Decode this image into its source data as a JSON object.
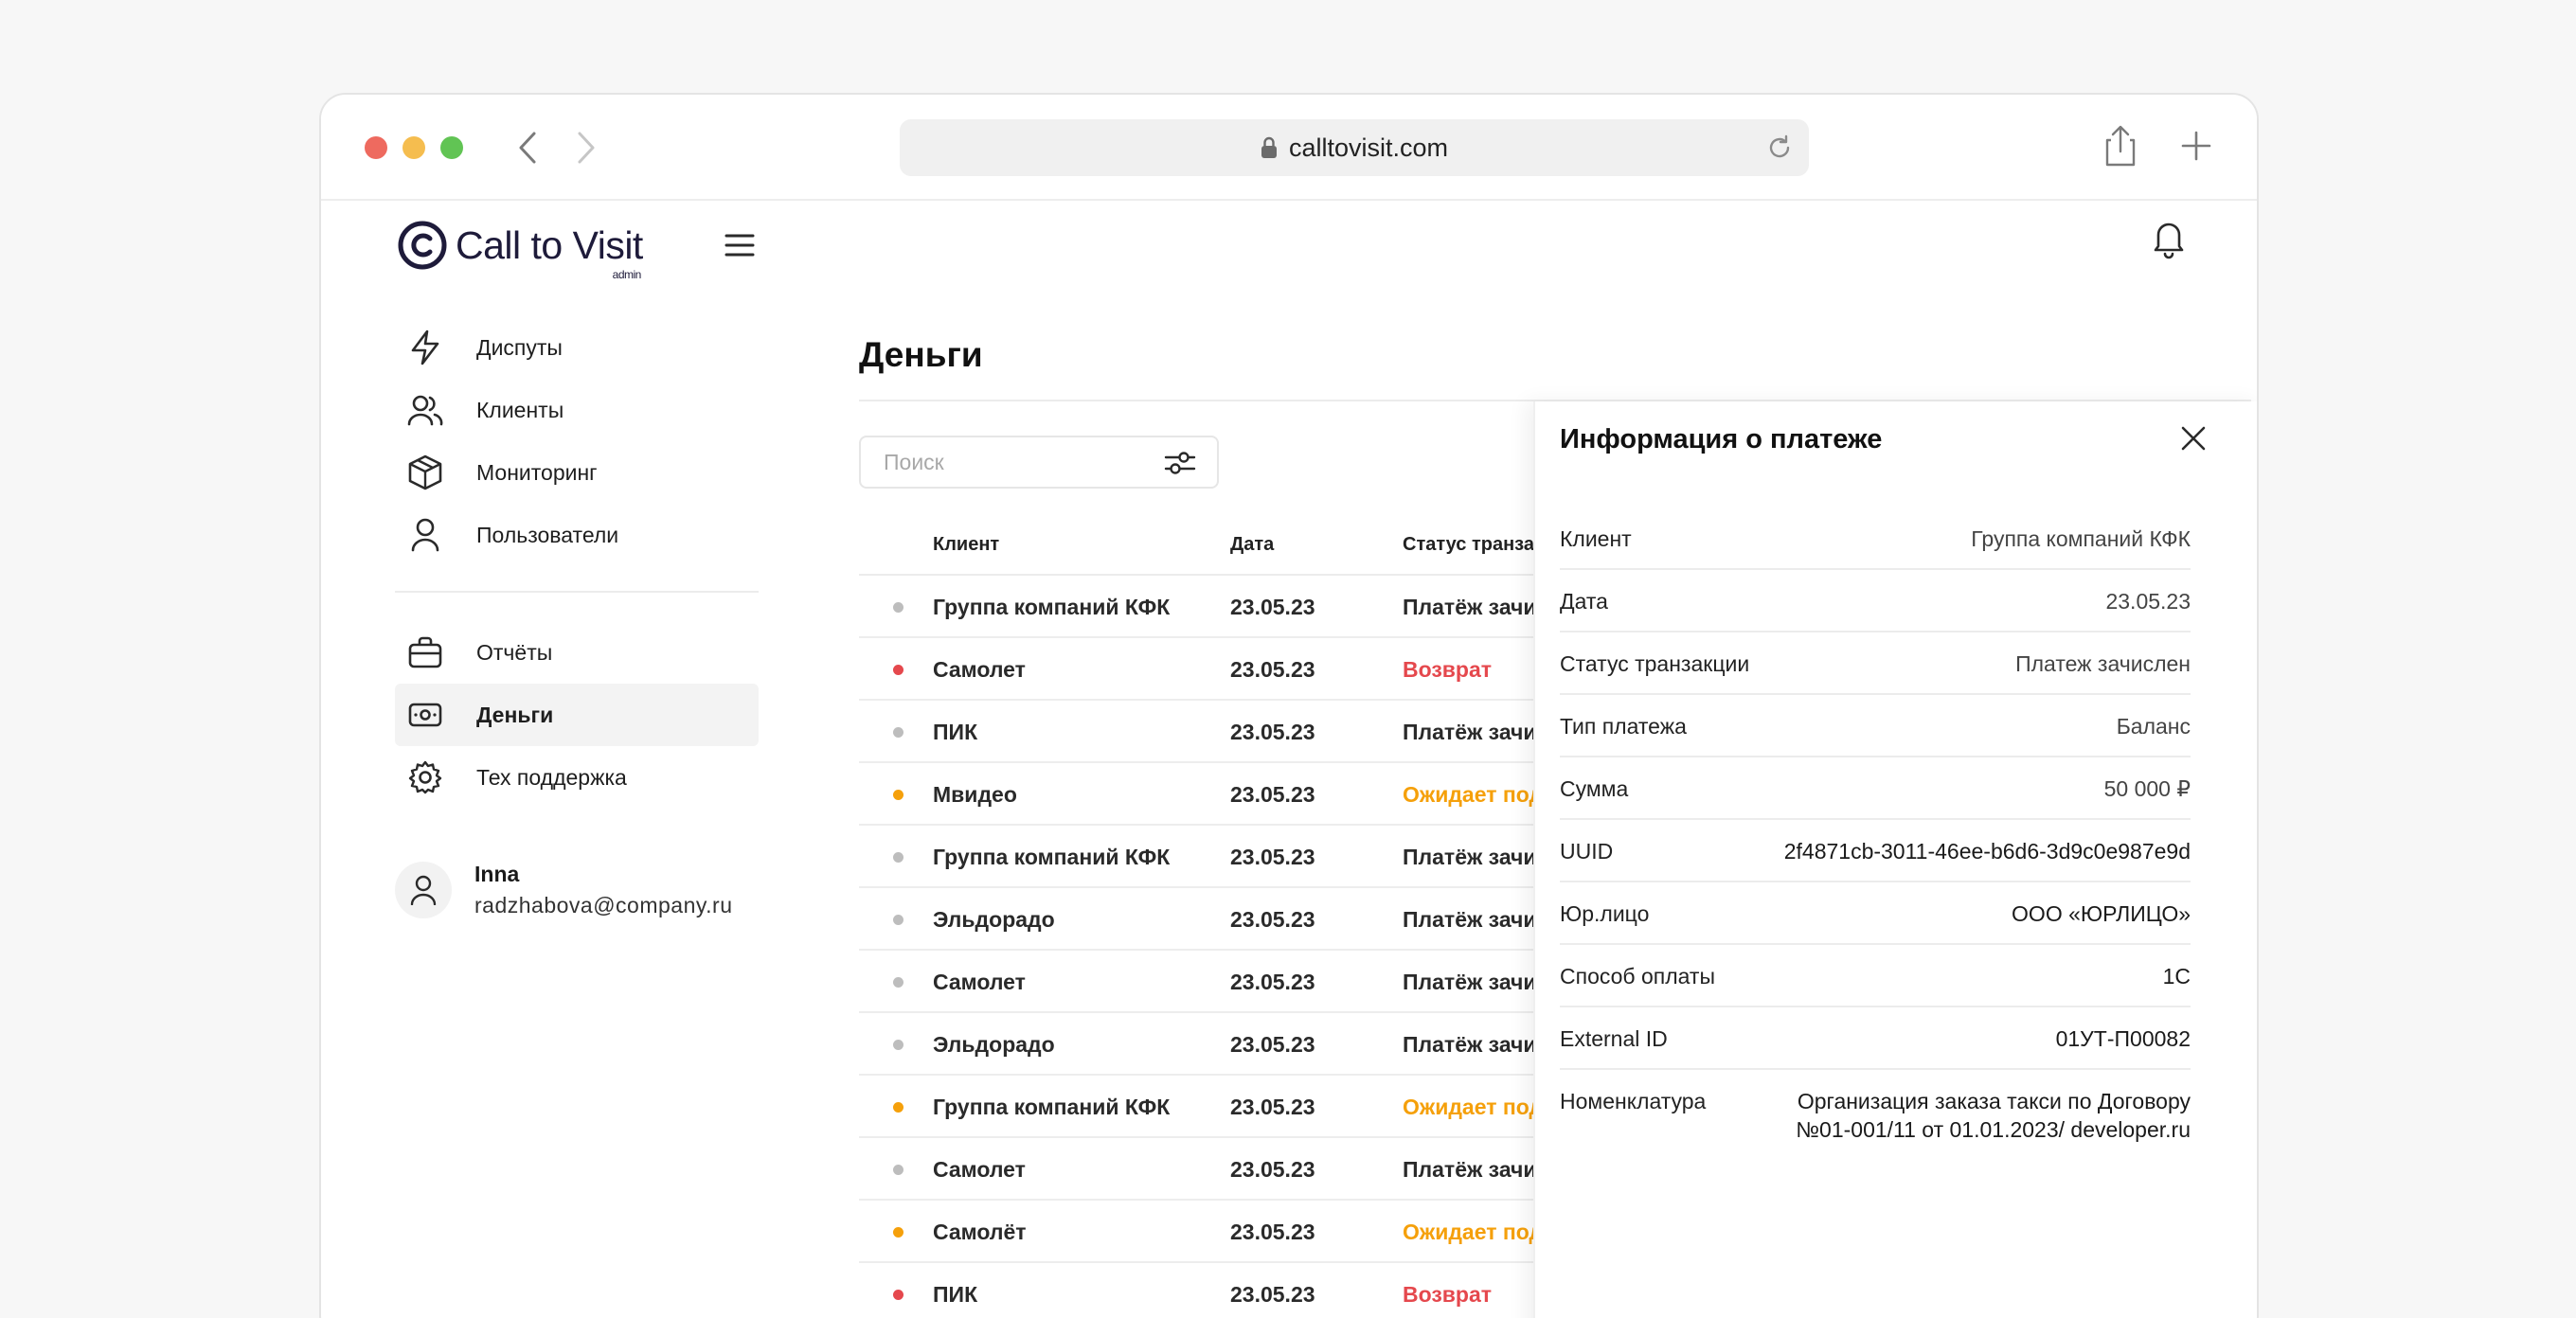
{
  "browser": {
    "url": "calltovisit.com"
  },
  "brand": {
    "name": "Call to Visit",
    "sub": "admin"
  },
  "sidebar": {
    "items": [
      {
        "label": "Диспуты",
        "icon": "lightning-icon"
      },
      {
        "label": "Клиенты",
        "icon": "users-icon"
      },
      {
        "label": "Мониторинг",
        "icon": "box-icon"
      },
      {
        "label": "Пользователи",
        "icon": "user-icon"
      },
      {
        "label": "Отчёты",
        "icon": "briefcase-icon"
      },
      {
        "label": "Деньги",
        "icon": "money-icon",
        "active": true
      },
      {
        "label": "Тех поддержка",
        "icon": "gear-icon"
      }
    ],
    "user": {
      "name": "Inna",
      "email": "radzhabova@company.ru"
    }
  },
  "main": {
    "title": "Деньги",
    "search_placeholder": "Поиск",
    "columns": [
      "Клиент",
      "Дата",
      "Статус транзакции"
    ],
    "rows": [
      {
        "client": "Группа компаний КФК",
        "date": "23.05.23",
        "status": "Платёж зачислен",
        "dot": "#bdbdbd",
        "color": "#2a2a2a"
      },
      {
        "client": "Самолет",
        "date": "23.05.23",
        "status": "Возврат",
        "dot": "#e5484d",
        "color": "#e5484d"
      },
      {
        "client": "ПИК",
        "date": "23.05.23",
        "status": "Платёж зачислен",
        "dot": "#bdbdbd",
        "color": "#2a2a2a"
      },
      {
        "client": "Мвидео",
        "date": "23.05.23",
        "status": "Ожидает подтверждения",
        "dot": "#f5a00b",
        "color": "#f5a00b"
      },
      {
        "client": "Группа компаний КФК",
        "date": "23.05.23",
        "status": "Платёж зачислен",
        "dot": "#bdbdbd",
        "color": "#2a2a2a"
      },
      {
        "client": "Эльдорадо",
        "date": "23.05.23",
        "status": "Платёж зачислен",
        "dot": "#bdbdbd",
        "color": "#2a2a2a"
      },
      {
        "client": "Самолет",
        "date": "23.05.23",
        "status": "Платёж зачислен",
        "dot": "#bdbdbd",
        "color": "#2a2a2a"
      },
      {
        "client": "Эльдорадо",
        "date": "23.05.23",
        "status": "Платёж зачислен",
        "dot": "#bdbdbd",
        "color": "#2a2a2a"
      },
      {
        "client": "Группа компаний КФК",
        "date": "23.05.23",
        "status": "Ожидает подтверждения",
        "dot": "#f5a00b",
        "color": "#f5a00b"
      },
      {
        "client": "Самолет",
        "date": "23.05.23",
        "status": "Платёж зачислен",
        "dot": "#bdbdbd",
        "color": "#2a2a2a"
      },
      {
        "client": "Самолёт",
        "date": "23.05.23",
        "status": "Ожидает подтверждения",
        "dot": "#f5a00b",
        "color": "#f5a00b"
      },
      {
        "client": "ПИК",
        "date": "23.05.23",
        "status": "Возврат",
        "dot": "#e5484d",
        "color": "#e5484d"
      }
    ]
  },
  "panel": {
    "title": "Информация о платеже",
    "fields": [
      {
        "label": "Клиент",
        "value": "Группа компаний КФК"
      },
      {
        "label": "Дата",
        "value": "23.05.23"
      },
      {
        "label": "Статус транзакции",
        "value": "Платеж зачислен"
      },
      {
        "label": "Тип платежа",
        "value": "Баланс"
      },
      {
        "label": "Сумма",
        "value": "50 000 ₽"
      },
      {
        "label": "UUID",
        "value": "2f4871cb-3011-46ee-b6d6-3d9c0e987e9d"
      },
      {
        "label": "Юр.лицо",
        "value": "ООО «ЮРЛИЦО»"
      },
      {
        "label": "Способ оплаты",
        "value": "1С"
      },
      {
        "label": "External ID",
        "value": "01УТ-П00082"
      },
      {
        "label": "Номенклатура",
        "value": "Организация заказа такси по Договору №01-001/11 от 01.01.2023/ developer.ru"
      }
    ]
  },
  "colors": {
    "accent": "#1e1b3a",
    "danger": "#e5484d",
    "warning": "#f5a00b",
    "neutral": "#bdbdbd"
  }
}
